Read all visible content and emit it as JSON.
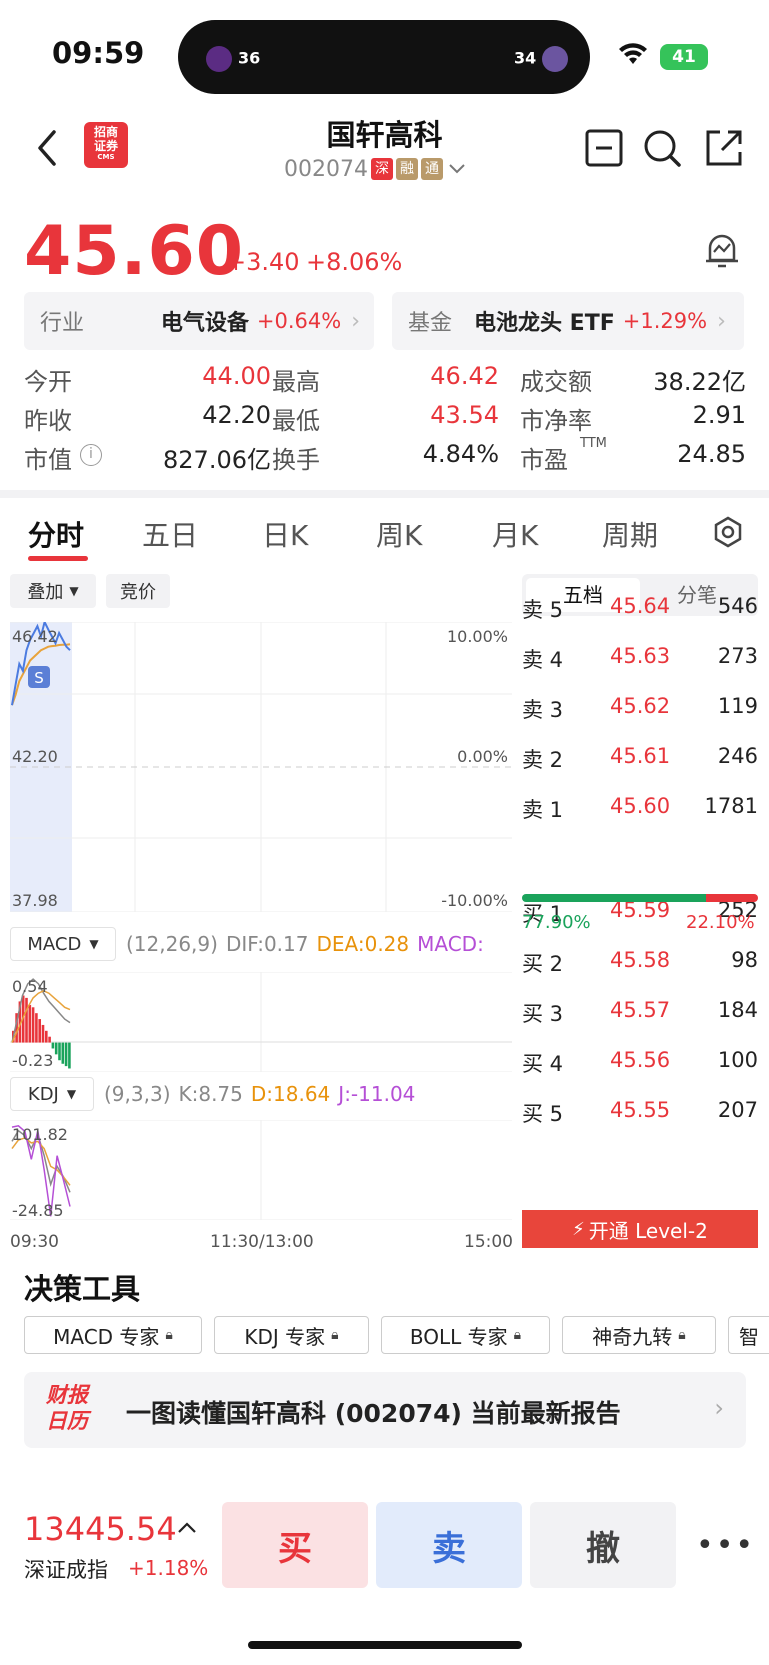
{
  "status_bar": {
    "time": "09:59",
    "score_left": "36",
    "score_right": "34",
    "battery": "41"
  },
  "header": {
    "broker_logo_text": "招商证券",
    "broker_logo_sub": "CMS",
    "stock_name": "国轩高科",
    "stock_code": "002074",
    "tags": [
      "深",
      "融",
      "通"
    ]
  },
  "quote": {
    "price": "45.60",
    "change": "+3.40",
    "change_pct": "+8.06%"
  },
  "industry": {
    "label": "行业",
    "name": "电气设备",
    "pct": "+0.64%"
  },
  "fund": {
    "label": "基金",
    "name": "电池龙头 ETF",
    "pct": "+1.29%"
  },
  "stats": [
    {
      "l1": "今开",
      "v1": "44.00",
      "l2": "最高",
      "v2": "46.42",
      "l3": "成交额",
      "v3": "38.22亿"
    },
    {
      "l1": "昨收",
      "v1": "42.20",
      "l2": "最低",
      "v2": "43.54",
      "l3": "市净率",
      "v3": "2.91"
    },
    {
      "l1": "市值",
      "v1": "827.06亿",
      "l2": "换手",
      "v2": "4.84%",
      "l3": "市盈",
      "l3_sup": "TTM",
      "v3": "24.85"
    }
  ],
  "tabs": [
    "分时",
    "五日",
    "日K",
    "周K",
    "月K",
    "周期"
  ],
  "chart_controls": {
    "overlay": "叠加",
    "auction": "竞价"
  },
  "chart_data": {
    "type": "line",
    "y_labels_left": [
      "46.42",
      "42.20",
      "37.98"
    ],
    "y_labels_right": [
      "10.00%",
      "0.00%",
      "-10.00%"
    ],
    "ylim": [
      37.98,
      46.42
    ],
    "x_labels": [
      "09:30",
      "11:30/13:00",
      "15:00"
    ],
    "marker": "S",
    "price_series": [
      44.0,
      44.6,
      45.2,
      45.0,
      45.6,
      45.9,
      46.1,
      46.3,
      46.0,
      46.42,
      46.2,
      46.0,
      45.8,
      46.1,
      45.9,
      45.7,
      45.6
    ],
    "avg_series": [
      44.0,
      44.3,
      44.7,
      44.9,
      45.1,
      45.3,
      45.4,
      45.5,
      45.6,
      45.65,
      45.7,
      45.72,
      45.73,
      45.75,
      45.76,
      45.76,
      45.77
    ]
  },
  "macd": {
    "name": "MACD",
    "params": "(12,26,9)",
    "dif": "DIF:0.17",
    "dea": "DEA:0.28",
    "macd": "MACD:",
    "max": "0.54",
    "min": "-0.23",
    "bars": [
      0.1,
      0.25,
      0.35,
      0.4,
      0.38,
      0.32,
      0.3,
      0.25,
      0.2,
      0.15,
      0.1,
      0.05,
      -0.05,
      -0.1,
      -0.15,
      -0.18,
      -0.2,
      -0.22
    ],
    "dif_series": [
      0.0,
      0.2,
      0.4,
      0.5,
      0.54,
      0.5,
      0.42,
      0.35,
      0.3,
      0.25,
      0.2,
      0.17
    ],
    "dea_series": [
      0.0,
      0.1,
      0.2,
      0.3,
      0.38,
      0.42,
      0.44,
      0.42,
      0.38,
      0.34,
      0.3,
      0.28
    ]
  },
  "kdj": {
    "name": "KDJ",
    "params": "(9,3,3)",
    "k": "K:8.75",
    "d": "D:18.64",
    "j": "J:-11.04",
    "max": "101.82",
    "min": "-24.85",
    "k_series": [
      80,
      95,
      88,
      70,
      90,
      60,
      20,
      45,
      30,
      8.75
    ],
    "d_series": [
      70,
      82,
      85,
      78,
      80,
      70,
      45,
      40,
      30,
      18.64
    ],
    "j_series": [
      100,
      101.82,
      94,
      55,
      95,
      40,
      -24.85,
      60,
      25,
      -11.04
    ]
  },
  "order_book": {
    "tabs": [
      "五档",
      "分笔"
    ],
    "asks": [
      {
        "label": "卖 5",
        "price": "45.64",
        "vol": "546"
      },
      {
        "label": "卖 4",
        "price": "45.63",
        "vol": "273"
      },
      {
        "label": "卖 3",
        "price": "45.62",
        "vol": "119"
      },
      {
        "label": "卖 2",
        "price": "45.61",
        "vol": "246"
      },
      {
        "label": "卖 1",
        "price": "45.60",
        "vol": "1781"
      }
    ],
    "ratio_buy": "77.90%",
    "ratio_sell": "22.10%",
    "ratio_buy_value": 0.779,
    "bids": [
      {
        "label": "买 1",
        "price": "45.59",
        "vol": "252"
      },
      {
        "label": "买 2",
        "price": "45.58",
        "vol": "98"
      },
      {
        "label": "买 3",
        "price": "45.57",
        "vol": "184"
      },
      {
        "label": "买 4",
        "price": "45.56",
        "vol": "100"
      },
      {
        "label": "买 5",
        "price": "45.55",
        "vol": "207"
      }
    ],
    "level2": "开通 Level-2"
  },
  "tools": {
    "title": "决策工具",
    "items": [
      "MACD 专家",
      "KDJ 专家",
      "BOLL 专家",
      "神奇九转",
      "智"
    ]
  },
  "report": {
    "logo_line1": "财报",
    "logo_line2": "日历",
    "text": "一图读懂国轩高科 (002074) 当前最新报告"
  },
  "bottom": {
    "index_value": "13445.54",
    "index_name": "深证成指",
    "index_pct": "+1.18%",
    "buy": "买",
    "sell": "卖",
    "cancel": "撤",
    "more": "•••"
  },
  "colors": {
    "up": "#e8353b",
    "down": "#1aa35b",
    "accent_blue": "#3a6fd8"
  }
}
